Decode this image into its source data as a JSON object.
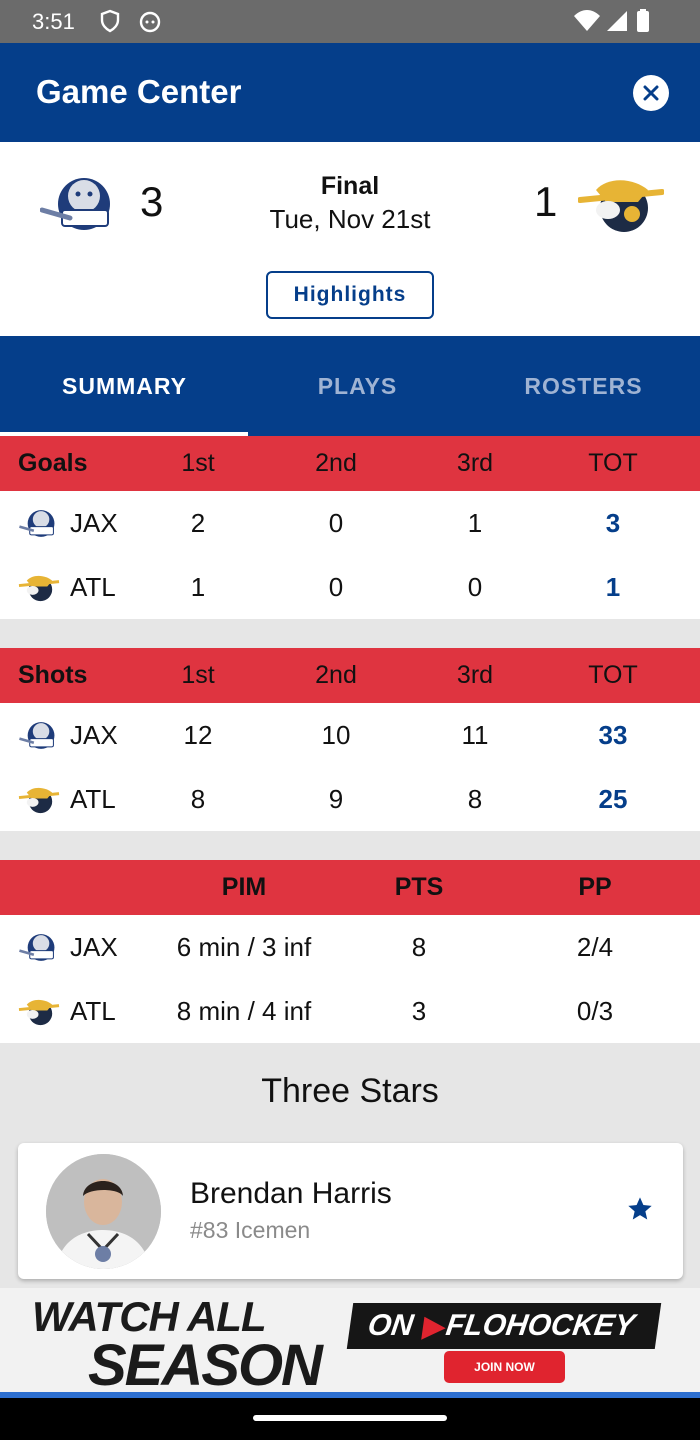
{
  "status_bar": {
    "time": "3:51"
  },
  "app_bar": {
    "title": "Game Center"
  },
  "game": {
    "home_score": "3",
    "away_score": "1",
    "status": "Final",
    "date": "Tue, Nov 21st",
    "highlights_label": "Highlights"
  },
  "tabs": [
    "SUMMARY",
    "PLAYS",
    "ROSTERS"
  ],
  "goals_table": {
    "label": "Goals",
    "headers": [
      "1st",
      "2nd",
      "3rd",
      "TOT"
    ],
    "rows": [
      {
        "team": "JAX",
        "values": [
          "2",
          "0",
          "1",
          "3"
        ]
      },
      {
        "team": "ATL",
        "values": [
          "1",
          "0",
          "0",
          "1"
        ]
      }
    ]
  },
  "shots_table": {
    "label": "Shots",
    "headers": [
      "1st",
      "2nd",
      "3rd",
      "TOT"
    ],
    "rows": [
      {
        "team": "JAX",
        "values": [
          "12",
          "10",
          "11",
          "33"
        ]
      },
      {
        "team": "ATL",
        "values": [
          "8",
          "9",
          "8",
          "25"
        ]
      }
    ]
  },
  "stats_table": {
    "headers": [
      "PIM",
      "PTS",
      "PP"
    ],
    "rows": [
      {
        "team": "JAX",
        "values": [
          "6 min / 3 inf",
          "8",
          "2/4"
        ]
      },
      {
        "team": "ATL",
        "values": [
          "8 min / 4 inf",
          "3",
          "0/3"
        ]
      }
    ]
  },
  "three_stars": {
    "title": "Three Stars",
    "players": [
      {
        "name": "Brendan Harris",
        "detail": "#83 Icemen"
      }
    ]
  },
  "ad": {
    "line1": "WATCH ALL",
    "line2": "SEASON",
    "on": "ON",
    "brand": "FLOHOCKEY",
    "cta": "JOIN NOW"
  },
  "colors": {
    "primary": "#053e8a",
    "header_red": "#df3440",
    "background": "#e6e6e6"
  }
}
